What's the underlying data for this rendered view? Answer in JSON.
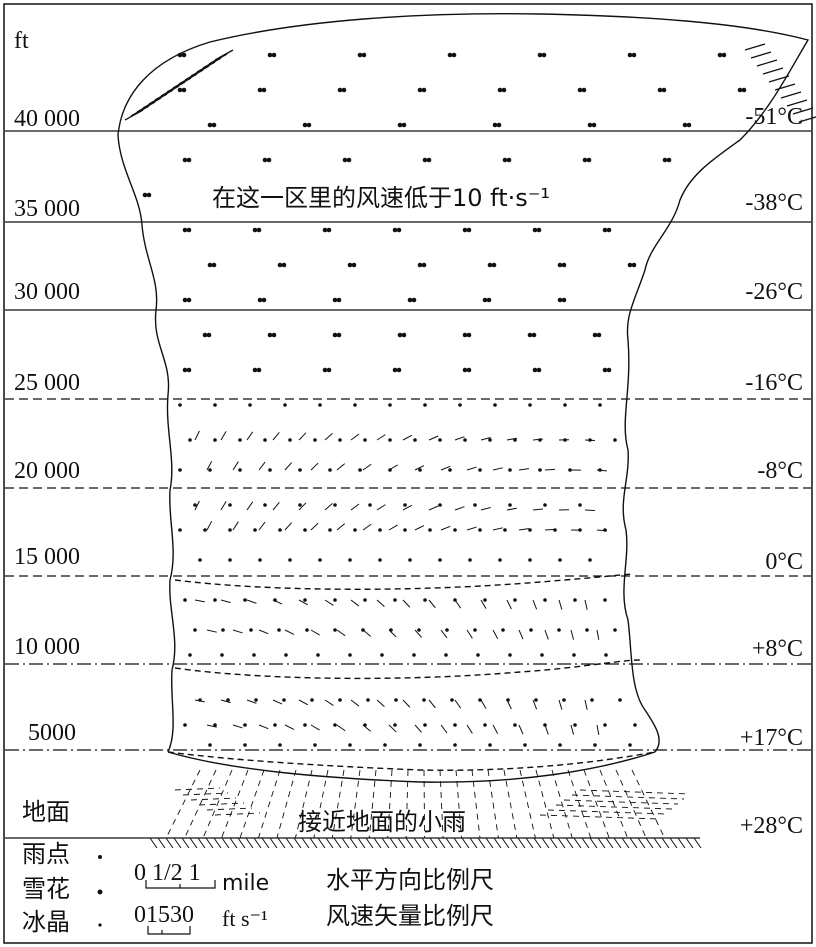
{
  "axis_unit": "ft",
  "altitude_labels": [
    "40 000",
    "35 000",
    "30 000",
    "25 000",
    "20 000",
    "15 000",
    "10 000",
    "5000"
  ],
  "temperature_labels": [
    "-51°C",
    "-38°C",
    "-26°C",
    "-16°C",
    "-8°C",
    "0°C",
    "+8°C",
    "+17°C",
    "+28°C"
  ],
  "annotations": {
    "upper_region": "在这一区里的风速低于10 ft·s⁻¹",
    "near_ground": "接近地面的小雨",
    "ground": "地面"
  },
  "legend": {
    "raindrop": "雨点",
    "snowflake": "雪花",
    "ice_crystal": "冰晶"
  },
  "scales": {
    "horizontal_numbers": "0 1/2 1",
    "horizontal_unit": "mile",
    "horizontal_caption": "水平方向比例尺",
    "wind_numbers": "01530",
    "wind_unit": "ft s⁻¹",
    "wind_caption": "风速矢量比例尺"
  },
  "colors": {
    "ink": "#111111",
    "background": "#ffffff"
  }
}
